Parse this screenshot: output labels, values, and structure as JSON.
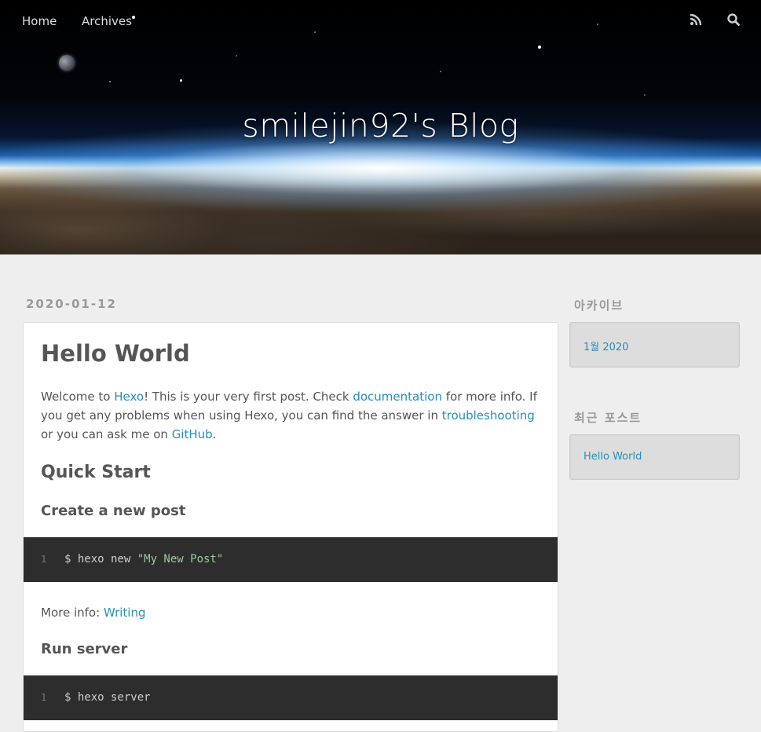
{
  "header": {
    "site_title": "smilejin92's Blog",
    "nav": [
      {
        "label": "Home"
      },
      {
        "label": "Archives"
      }
    ],
    "icons": [
      "rss-icon",
      "search-icon"
    ]
  },
  "post": {
    "date": "2020-01-12",
    "title": "Hello World",
    "intro": {
      "t1": "Welcome to ",
      "l1": "Hexo",
      "t2": "! This is your very first post. Check ",
      "l2": "documentation",
      "t3": " for more info. If you get any problems when using Hexo, you can find the answer in ",
      "l3": "troubleshooting",
      "t4": " or you can ask me on ",
      "l4": "GitHub",
      "t5": "."
    },
    "quick_start": "Quick Start",
    "create_post_heading": "Create a new post",
    "code1": {
      "line": "1",
      "cmd": "$ hexo new ",
      "arg": "\"My New Post\""
    },
    "more_info_label": "More info: ",
    "more_info_link": "Writing",
    "run_server_heading": "Run server",
    "code2": {
      "line": "1",
      "cmd": "$ hexo server"
    }
  },
  "sidebar": {
    "archive_title": "아카이브",
    "archive_items": [
      "1월 2020"
    ],
    "recent_title": "최근 포스트",
    "recent_items": [
      "Hello World"
    ]
  },
  "colors": {
    "link": "#258fb8",
    "code_bg": "#2d2d2d",
    "code_string": "#99cc99",
    "page_bg": "#eeeeee"
  }
}
